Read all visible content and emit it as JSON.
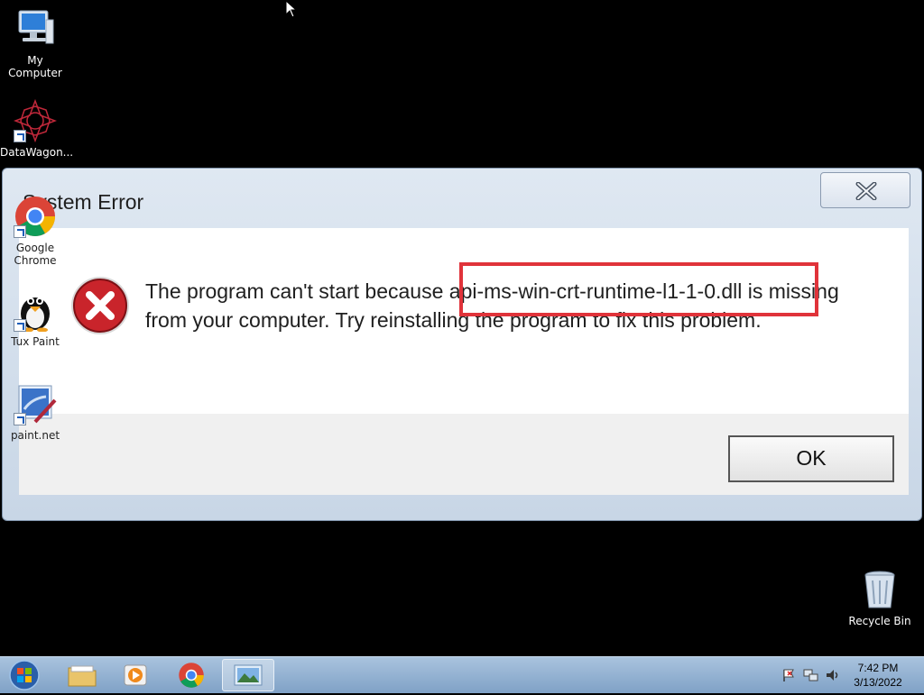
{
  "desktop": {
    "icons": [
      {
        "label": "My Computer"
      },
      {
        "label": "DataWagon..."
      },
      {
        "label": "Google Chrome"
      },
      {
        "label": "Tux Paint"
      },
      {
        "label": "paint.net"
      },
      {
        "label": "Recycle Bin"
      }
    ]
  },
  "dialog": {
    "title": "System Error",
    "message": "The program can't start because api-ms-win-crt-runtime-l1-1-0.dll is missing from your computer. Try reinstalling the program to fix this problem.",
    "ok_label": "OK",
    "highlight_color": "#e0333a"
  },
  "taskbar": {
    "time": "7:42 PM",
    "date": "3/13/2022",
    "items": [
      "start-orb",
      "file-explorer",
      "media-player",
      "google-chrome",
      "photo-viewer"
    ]
  }
}
